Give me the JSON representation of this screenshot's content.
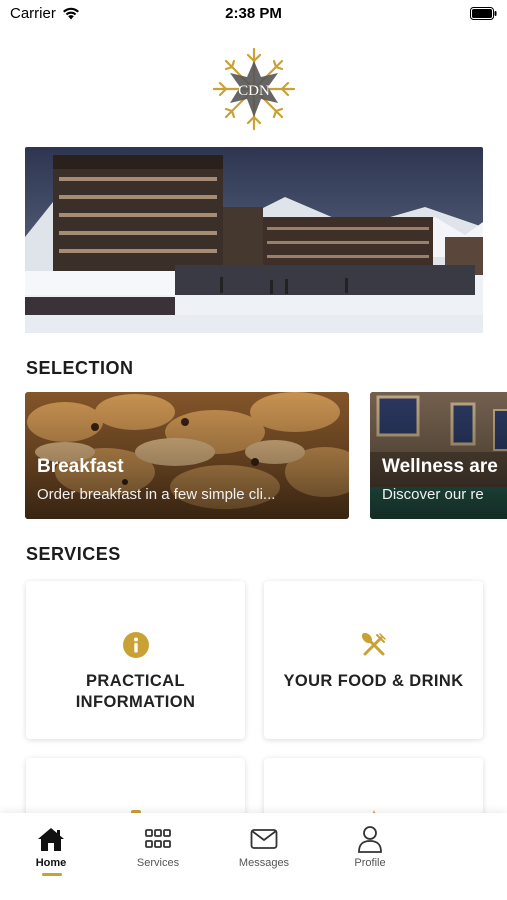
{
  "status_bar": {
    "carrier": "Carrier",
    "time": "2:38 PM"
  },
  "logo": {
    "monogram": "CDN",
    "icon": "snowflake-star-logo",
    "color": "#c9a135"
  },
  "hero": {
    "alt": "hotel-building-snow-photo"
  },
  "selection": {
    "title": "SELECTION",
    "cards": [
      {
        "title": "Breakfast",
        "subtitle": "Order breakfast in a few simple cli..."
      },
      {
        "title": "Wellness are",
        "subtitle": "Discover our re"
      }
    ]
  },
  "services": {
    "title": "SERVICES",
    "tiles": [
      {
        "label_line1": "PRACTICAL",
        "label_line2": "INFORMATION",
        "icon": "info-circle-icon"
      },
      {
        "label_line1": "YOUR FOOD & DRINK",
        "label_line2": "",
        "icon": "fork-knife-icon"
      },
      {
        "label_line1": "",
        "label_line2": "",
        "icon": "partial-icon"
      },
      {
        "label_line1": "",
        "label_line2": "",
        "icon": "partial-icon"
      }
    ]
  },
  "nav": {
    "items": [
      {
        "label": "Home",
        "icon": "home-icon",
        "active": true
      },
      {
        "label": "Services",
        "icon": "grid-icon",
        "active": false
      },
      {
        "label": "Messages",
        "icon": "envelope-icon",
        "active": false
      },
      {
        "label": "Profile",
        "icon": "user-icon",
        "active": false
      }
    ]
  },
  "colors": {
    "accent": "#c9a135",
    "text": "#1c1c1c"
  }
}
